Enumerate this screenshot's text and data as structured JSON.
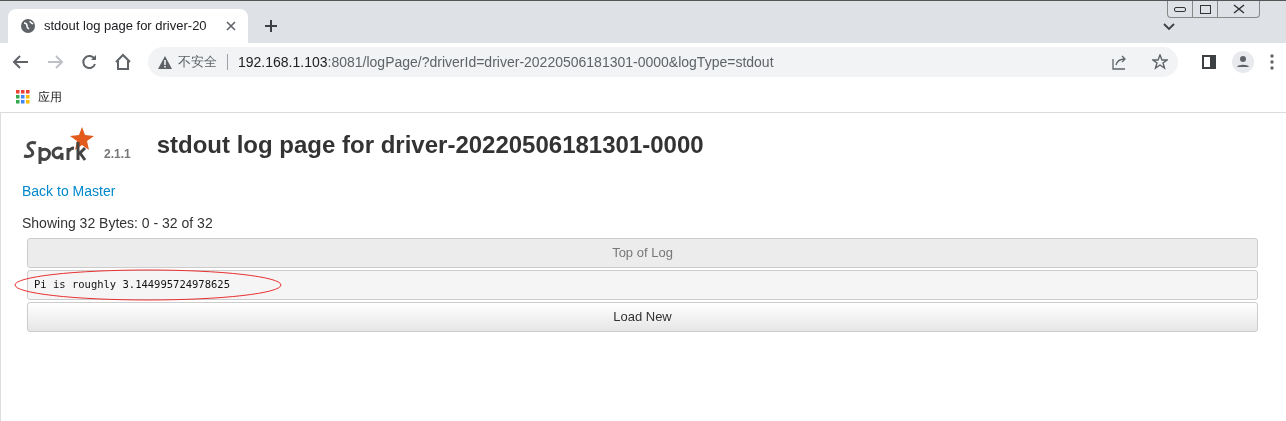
{
  "browser": {
    "tab": {
      "title": "stdout log page for driver-20",
      "selected": true
    },
    "address": {
      "security": "不安全",
      "host": "192.168.1.103",
      "rest": ":8081/logPage/?driverId=driver-20220506181301-0000&logType=stdout"
    },
    "bookmarks": [
      {
        "label": "应用"
      }
    ]
  },
  "page": {
    "logo_version": "2.1.1",
    "title": "stdout log page for driver-20220506181301-0000",
    "back_link": "Back to Master",
    "range": "Showing 32 Bytes: 0 - 32 of 32",
    "top_button": {
      "label": "Top of Log",
      "disabled": true
    },
    "log_lines": [
      "Pi is roughly 3.144995724978625"
    ],
    "load_button": {
      "label": "Load New",
      "disabled": false
    }
  }
}
